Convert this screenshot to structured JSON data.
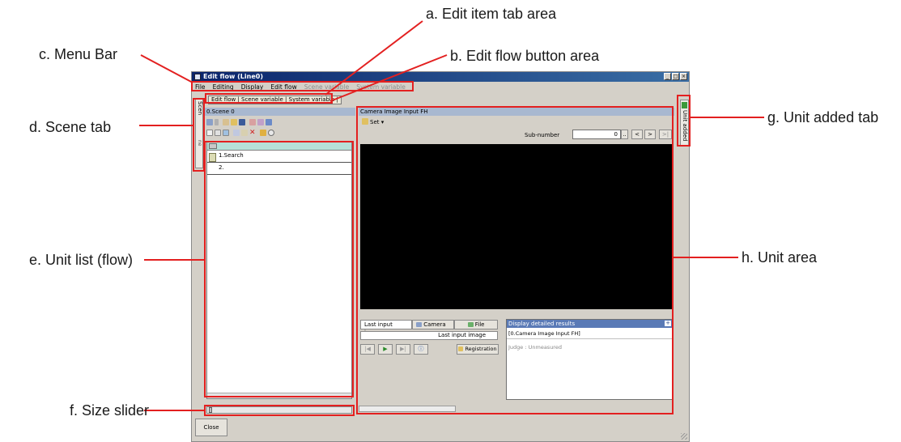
{
  "annotations": {
    "a": "a. Edit item tab area",
    "b": "b. Edit flow button area",
    "c": "c. Menu Bar",
    "d": "d. Scene tab",
    "e": "e. Unit list (flow)",
    "f": "f. Size slider",
    "g": "g. Unit added tab",
    "h": "h. Unit area",
    "highlight_color": "#e32020"
  },
  "window": {
    "title": "Edit flow (Line0)",
    "controls": [
      "_",
      "□",
      "×"
    ]
  },
  "menu": {
    "items": [
      "File",
      "Editing",
      "Display",
      "Edit flow",
      "Scene variable",
      "System variable"
    ],
    "disabled": [
      "Scene variable",
      "System variable"
    ]
  },
  "tabs": {
    "strip": "Edit flow | Scene variable | System variable |"
  },
  "scene_tab": {
    "label": "Scen",
    "sub_label": "ne"
  },
  "left": {
    "scene_title": "0.Scene 0",
    "units": [
      "1.Search",
      "2."
    ]
  },
  "right": {
    "unit_title": "Camera Image Input FH",
    "set_label": "Set",
    "sub_number_label": "Sub-number",
    "sub_number_value": "0",
    "subnum_buttons": [
      "..",
      "<",
      ">",
      ">|"
    ],
    "image_tabs": [
      "Last input image",
      "Camera",
      "File"
    ],
    "image_field": "Last input image",
    "registration": "Registration",
    "results_title": "Display detailed results",
    "results_line1": "[0.Camera Image Input FH]",
    "results_line2": "Judge : Unmeasured"
  },
  "unit_added_tab": {
    "label": "Unit added"
  },
  "bottom": {
    "close": "Close"
  }
}
